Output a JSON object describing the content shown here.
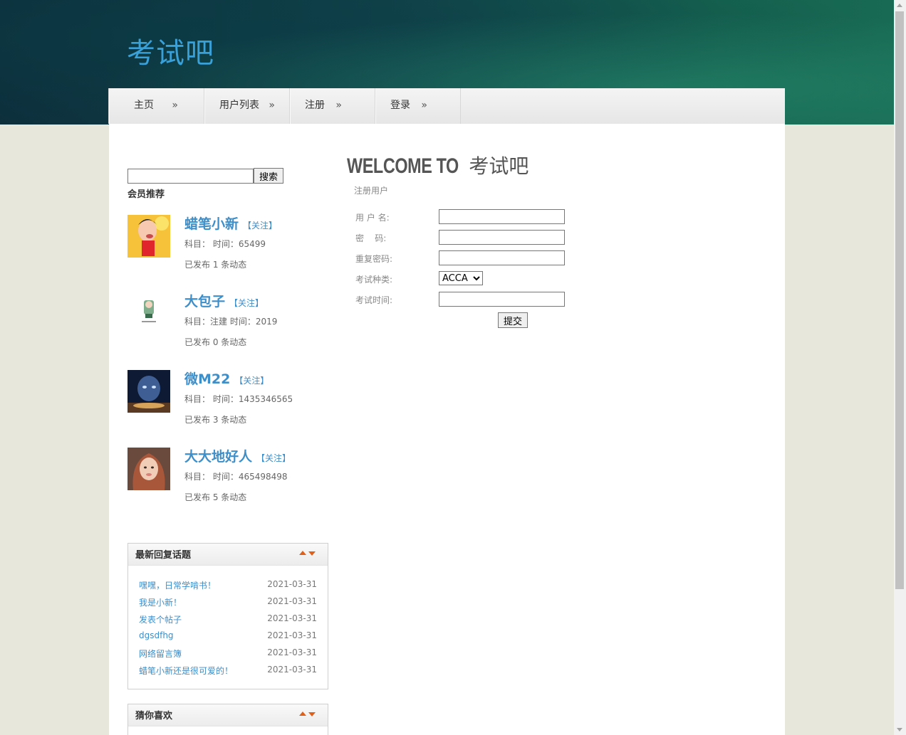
{
  "site": {
    "logo": "考试吧"
  },
  "nav": [
    {
      "label": "主页",
      "arrow": "»"
    },
    {
      "label": "用户列表",
      "arrow": "»"
    },
    {
      "label": "注册",
      "arrow": "»"
    },
    {
      "label": "登录",
      "arrow": "»"
    }
  ],
  "sidebar": {
    "search": {
      "value": "",
      "button": "搜索"
    },
    "members_title": "会员推荐",
    "members": [
      {
        "name": "蜡笔小新",
        "follow": "【关注】",
        "info": "科目：  时间：65499",
        "posts": "已发布 1 条动态"
      },
      {
        "name": "大包子",
        "follow": "【关注】",
        "info": "科目：注建 时间：2019",
        "posts": "已发布 0 条动态"
      },
      {
        "name": "微M22",
        "follow": "【关注】",
        "info": "科目：  时间：1435346565",
        "posts": "已发布 3 条动态"
      },
      {
        "name": "大大地好人",
        "follow": "【关注】",
        "info": "科目：  时间：465498498",
        "posts": "已发布 5 条动态"
      }
    ],
    "latest": {
      "title": "最新回复话题",
      "items": [
        {
          "title": "嘿嘿，日常学啃书！",
          "date": "2021-03-31"
        },
        {
          "title": "我是小新！",
          "date": "2021-03-31"
        },
        {
          "title": "发表个帖子",
          "date": "2021-03-31"
        },
        {
          "title": "dgsdfhg",
          "date": "2021-03-31"
        },
        {
          "title": "网络留言簿",
          "date": "2021-03-31"
        },
        {
          "title": "蜡笔小新还是很可爱的！",
          "date": "2021-03-31"
        }
      ]
    },
    "guess": {
      "title": "猜你喜欢"
    }
  },
  "main": {
    "welcome_en": "WELCOME TO",
    "welcome_cn": "考试吧",
    "subtitle": "注册用户",
    "form": {
      "username_label": "用 户 名:",
      "password_label": "密    码:",
      "repeat_label": "重复密码:",
      "type_label": "考试种类:",
      "type_selected": "ACCA",
      "time_label": "考试时间:",
      "submit": "提交"
    }
  },
  "colors": {
    "accent": "#3d8ec9",
    "logo": "#3aa0d8",
    "arrow": "#e0601a"
  }
}
